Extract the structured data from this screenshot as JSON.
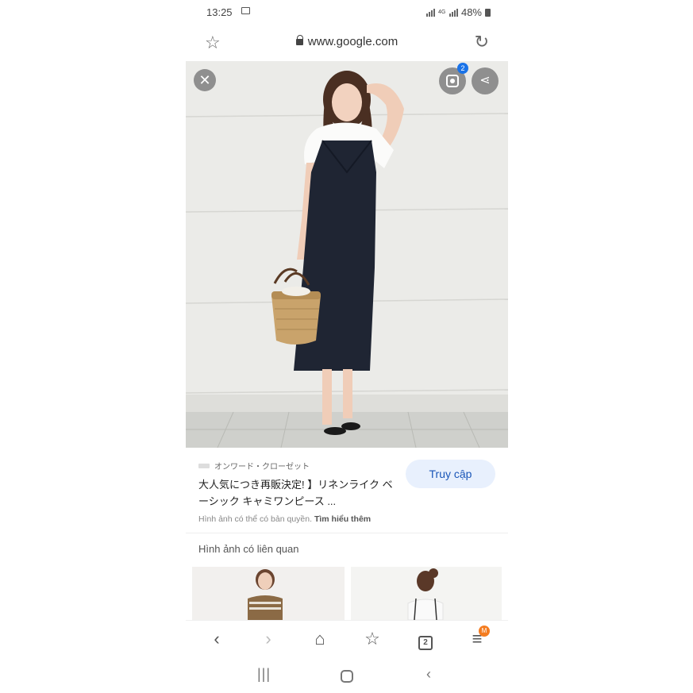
{
  "status_bar": {
    "time": "13:25",
    "network": "4G",
    "battery": "48%"
  },
  "browser": {
    "url": "www.google.com"
  },
  "image_viewer": {
    "lens_badge": "2"
  },
  "result": {
    "source": "オンワード・クローゼット",
    "visit_label": "Truy cập",
    "title": "大人気につき再販決定! 】リネンライク ベーシック キャミワンピース ...",
    "copyright_text": "Hình ảnh có thể có bản quyền.",
    "learn_more": "Tìm hiểu thêm"
  },
  "related": {
    "heading": "Hình ảnh có liên quan"
  },
  "bottom_nav": {
    "tabs_count": "2",
    "menu_badge": "M"
  },
  "colors": {
    "accent": "#1a73e8",
    "visit_bg": "#e8f0fd",
    "badge_orange": "#f47c20"
  }
}
